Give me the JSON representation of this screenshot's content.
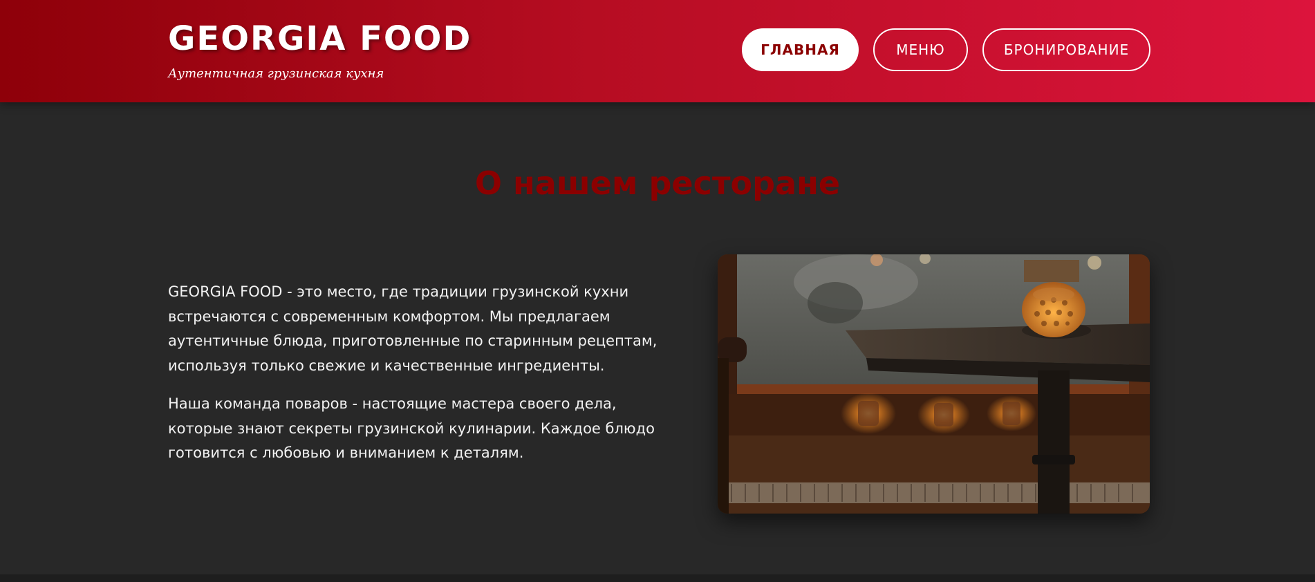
{
  "header": {
    "logo_title": "GEORGIA FOOD",
    "logo_subtitle": "Аутентичная грузинская кухня",
    "nav": [
      {
        "label": "ГЛАВНАЯ",
        "active": true
      },
      {
        "label": "МЕНЮ",
        "active": false
      },
      {
        "label": "БРОНИРОВАНИЕ",
        "active": false
      }
    ]
  },
  "about": {
    "title": "О нашем ресторане",
    "paragraphs": [
      "GEORGIA FOOD - это место, где традиции грузинской кухни встречаются с современным комфортом. Мы предлагаем аутентичные блюда, приготовленные по старинным рецептам, используя только свежие и качественные ингредиенты.",
      "Наша команда поваров - настоящие мастера своего дела, которые знают секреты грузинской кулинарии. Каждое блюдо готовится с любовью и вниманием к деталям."
    ],
    "image": "restaurant-interior-photo"
  },
  "colors": {
    "brand_dark": "#8b0000",
    "brand_light": "#dc143c",
    "background": "#282828"
  }
}
